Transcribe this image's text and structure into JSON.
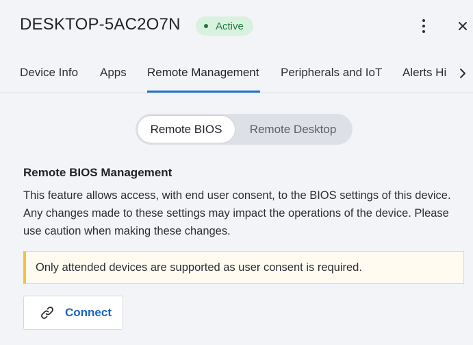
{
  "header": {
    "title": "DESKTOP-5AC2O7N",
    "status": "Active",
    "status_color": "#1e7a3e",
    "more_icon": "kebab-vertical-icon",
    "close_icon": "close-icon"
  },
  "tabs": [
    {
      "label": "Device Info",
      "active": false
    },
    {
      "label": "Apps",
      "active": false
    },
    {
      "label": "Remote Management",
      "active": true
    },
    {
      "label": "Peripherals and IoT",
      "active": false
    },
    {
      "label": "Alerts Hi",
      "active": false
    }
  ],
  "tab_scroll_icon": "chevron-right-icon",
  "accent_color": "#1f6fd1",
  "toggle": {
    "options": [
      "Remote BIOS",
      "Remote Desktop"
    ],
    "selected": "Remote BIOS"
  },
  "bios": {
    "title": "Remote BIOS Management",
    "description": "This feature allows access, with end user consent, to the BIOS settings of this device. Any changes made to these settings may impact the operations of the device. Please use caution when making these changes.",
    "notice": "Only attended devices are supported as user consent is required.",
    "connect_label": "Connect",
    "connect_icon": "link-icon"
  }
}
